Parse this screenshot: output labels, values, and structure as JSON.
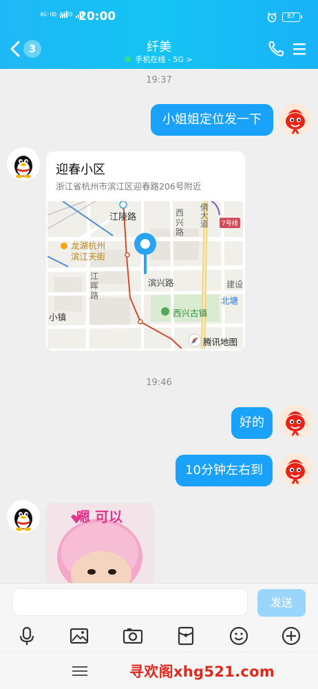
{
  "status_bar": {
    "signal1": "4G⁺HD",
    "signal2": "4GHD",
    "time": "20:00",
    "battery": "87"
  },
  "header": {
    "unread_count": "3",
    "contact_name": "纤美",
    "presence": "手机在线 - 5G >",
    "accent_color": "#14c3f3"
  },
  "messages": {
    "timestamp1": "19:37",
    "sent1": "小姐姐定位发一下",
    "location": {
      "name": "迎春小区",
      "address": "浙江省杭州市滨江区迎春路206号附近",
      "map_labels": {
        "road1": "江陵路",
        "road2a": "西",
        "road2b": "兴",
        "road2c": "路",
        "road3a": "倩",
        "road3b": "大",
        "road3c": "道",
        "metro": "7号线",
        "poi1a": "龙湖杭州",
        "poi1b": "滨江天街",
        "road4a": "江",
        "road4b": "晖",
        "road4c": "路",
        "road5": "滨兴路",
        "road6": "建设",
        "road7": "北塘",
        "town": "小镇",
        "poi2": "西兴古镇",
        "brand": "腾讯地图"
      }
    },
    "timestamp2": "19:46",
    "sent2": "好的",
    "sent3": "10分钟左右到",
    "sticker_text": "嗯 可以"
  },
  "input": {
    "placeholder": "",
    "send_label": "发送"
  },
  "toolbar_icons": [
    "microphone-icon",
    "image-icon",
    "camera-icon",
    "red-packet-icon",
    "emoji-icon",
    "plus-icon"
  ],
  "watermark": "寻欢阁xhg521.com"
}
